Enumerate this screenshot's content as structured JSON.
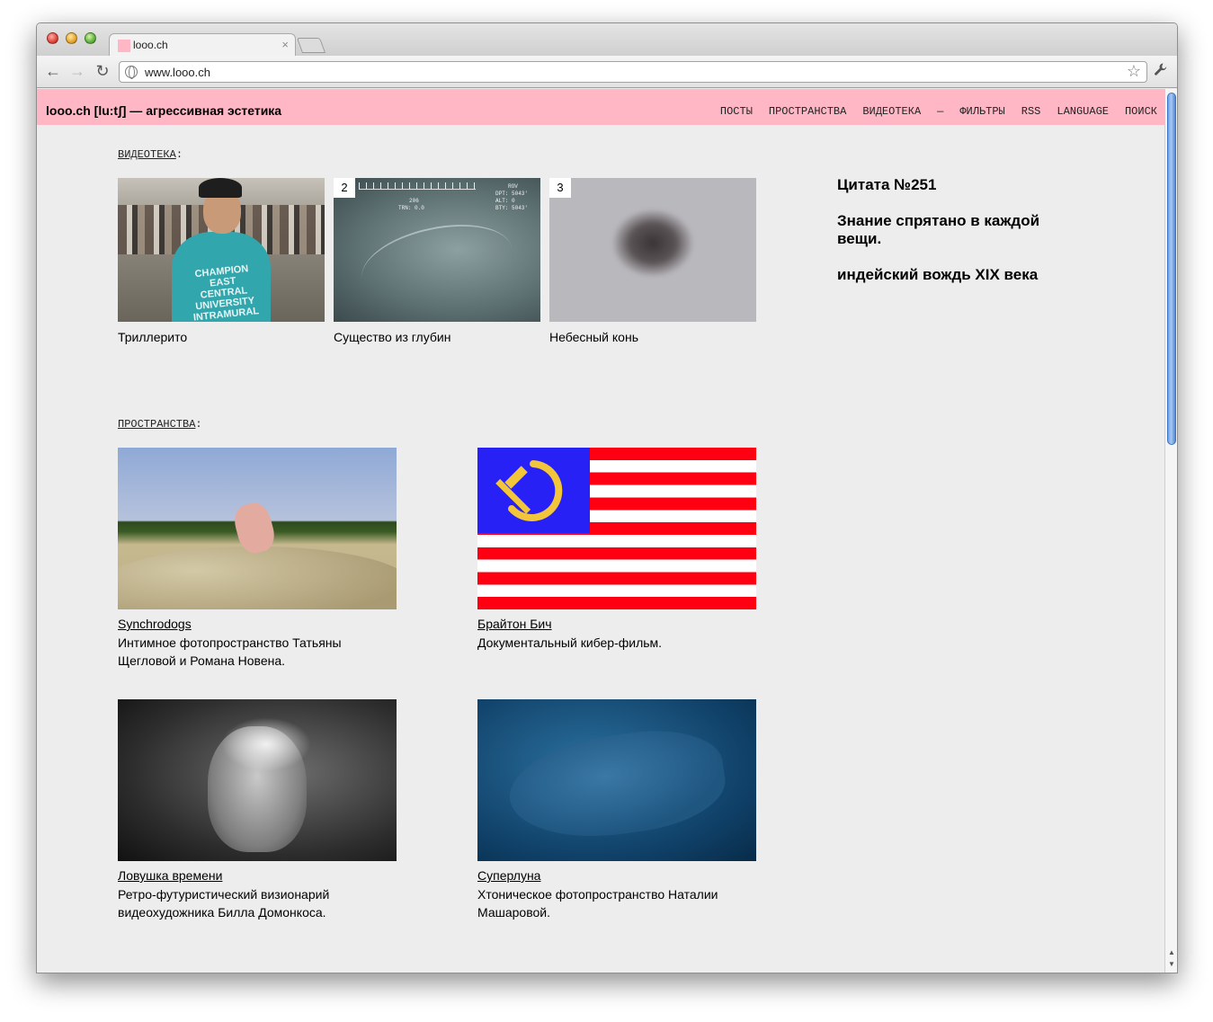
{
  "browser": {
    "tab_title": "looo.ch",
    "tab_close": "×",
    "url": "www.looo.ch",
    "back_icon": "←",
    "forward_icon": "→",
    "reload_icon": "↻",
    "bookmark_icon": "☆",
    "wrench_icon": "🔧"
  },
  "site": {
    "logo": "looo.ch [lu:tʃ] — агрессивная эстетика",
    "menu": [
      "ПОСТЫ",
      "ПРОСТРАНСТВА",
      "ВИДЕОТЕКА",
      "—",
      "ФИЛЬТРЫ",
      "RSS",
      "LANGUAGE",
      "ПОИСК"
    ],
    "brand_color": "#ffb7c5"
  },
  "videoteka": {
    "label": "ВИДЕОТЕКА",
    "items": [
      {
        "title": "Триллерито",
        "shirt_text": "CHAMPION EAST CENTRAL UNIVERSITY INTRAMURAL"
      },
      {
        "number": "2",
        "title": "Существо из глубин",
        "hud": [
          "ROV",
          "DPT: 5043'",
          "ALT: 0",
          "BTY: 5043'",
          "206",
          "TRN: 0.0"
        ]
      },
      {
        "number": "3",
        "title": "Небесный конь"
      }
    ]
  },
  "quote": {
    "title": "Цитата №251",
    "text": "Знание спрятано в каждой вещи.",
    "author": "индейский вождь XIX века"
  },
  "prostranstva": {
    "label": "ПРОСТРАНСТВА",
    "items": [
      {
        "title": "Synchrodogs",
        "desc": "Интимное фотопространство Татьяны Щегловой и Романа Новена."
      },
      {
        "title": "Брайтон Бич",
        "desc": "Документальный кибер-фильм."
      },
      {
        "title": "Ловушка времени",
        "desc": "Ретро-футуристический визионарий видеохудожника Билла Домонкоса."
      },
      {
        "title": "Суперлуна",
        "desc": "Хтоническое фотопространство Наталии Машаровой."
      }
    ]
  }
}
